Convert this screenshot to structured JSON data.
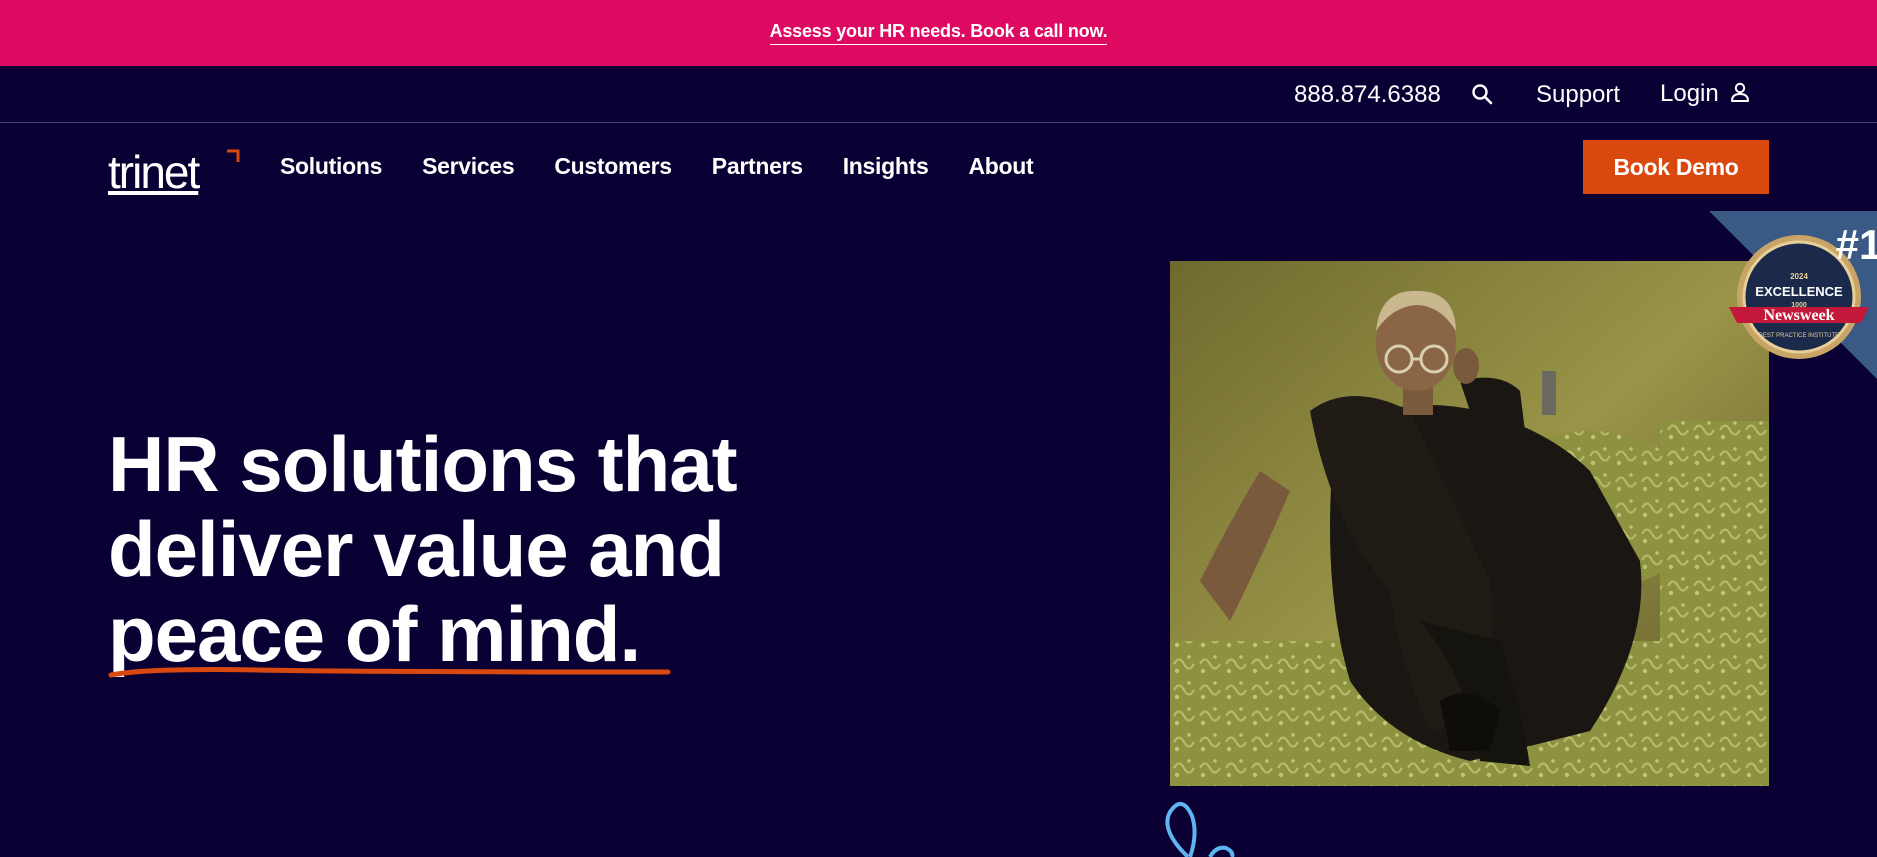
{
  "promo": {
    "text": "Assess your HR needs. Book a call now."
  },
  "utility": {
    "phone": "888.874.6388",
    "support": "Support",
    "login": "Login"
  },
  "nav": {
    "logo": "trinet",
    "items": [
      "Solutions",
      "Services",
      "Customers",
      "Partners",
      "Insights",
      "About"
    ],
    "cta": "Book Demo"
  },
  "hero": {
    "line1": "HR solutions that",
    "line2": "deliver value and",
    "line3": "peace of mind."
  },
  "badge": {
    "rank": "#1",
    "year": "2024",
    "title": "EXCELLENCE",
    "count": "1000",
    "brand": "Newsweek",
    "sub": "BEST PRACTICE INSTITUTE"
  },
  "colors": {
    "background": "#0b0033",
    "promo": "#de0a62",
    "accent": "#d9480f",
    "ribbon": "#3a5a86"
  },
  "icons": {
    "search": "search-icon",
    "login": "user-icon",
    "badge": "award-badge-icon"
  }
}
